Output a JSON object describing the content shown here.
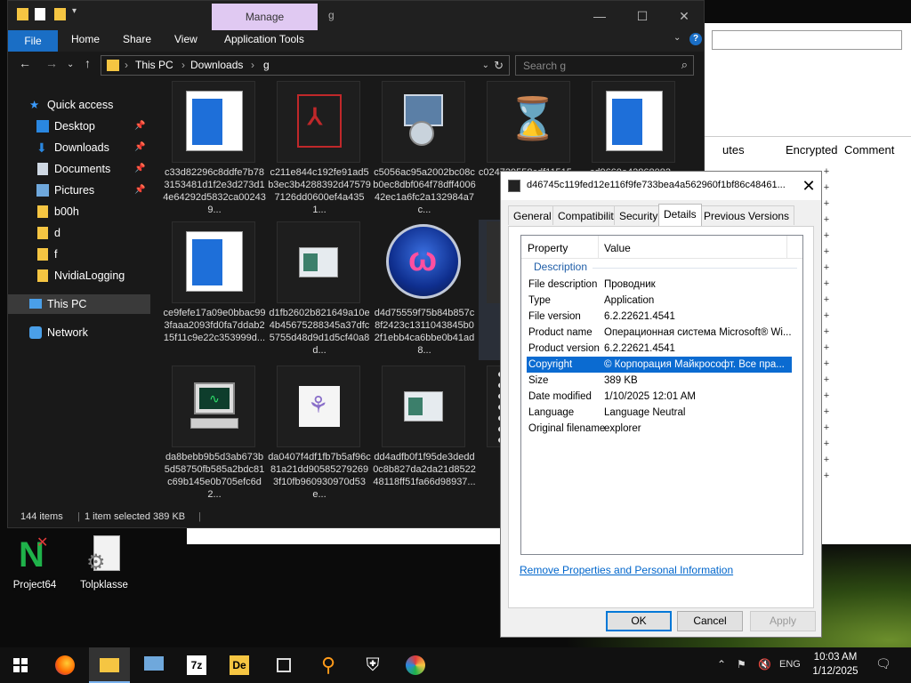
{
  "background_window": {
    "columns": [
      "utes",
      "Encrypted",
      "Comment"
    ],
    "plus_marks": [
      "+",
      "+",
      "+",
      "+",
      "+",
      "+",
      "+",
      "+",
      "+",
      "+",
      "+",
      "+",
      "+",
      "+",
      "+",
      "+",
      "+",
      "+",
      "+",
      "+"
    ]
  },
  "explorer": {
    "manage_tab": "Manage",
    "title": "g",
    "ribbon_tabs": [
      "File",
      "Home",
      "Share",
      "View",
      "Application Tools"
    ],
    "breadcrumb": [
      "This PC",
      "Downloads",
      "g"
    ],
    "search_placeholder": "Search g",
    "nav": {
      "quick_access": "Quick access",
      "desktop": "Desktop",
      "downloads": "Downloads",
      "documents": "Documents",
      "pictures": "Pictures",
      "b00h": "b00h",
      "d": "d",
      "f": "f",
      "nvidia": "NvidiaLogging",
      "this_pc": "This PC",
      "network": "Network"
    },
    "files": [
      {
        "name": "c33d82296c8ddfe7b783153481d1f2e3d273d14e64292d5832ca002439..."
      },
      {
        "name": "c211e844c192fe91ad5b3ec3b4288392d475797126dd0600ef4a4351..."
      },
      {
        "name": "c5056ac95a2002bc08cb0ec8dbf064f78dff400642ec1a6fc2a132984a7c..."
      },
      {
        "name": "c024729558cdf11515..."
      },
      {
        "name": "cd9660e42868082..."
      },
      {
        "name": "ce9fefe17a09e0bbac993faaa2093fd0fa7ddab215f11c9e22c353999d..."
      },
      {
        "name": "d1fb2602b821649a10e4b45675288345a37dfc5755d48d9d1d5cf40a8d..."
      },
      {
        "name": "d4d75559f75b84b857c8f2423c1311043845b02f1ebb4ca6bbe0b41ad8..."
      },
      {
        "name": "d46..."
      },
      {
        "name": "da8bebb9b5d3ab673b5d58750fb585a2bdc81c69b145e0b705efc6d2..."
      },
      {
        "name": "da0407f4df1fb7b5af96c81a21dd905852792693f10fb960930970d53e..."
      },
      {
        "name": "dd4adfb0f1f95de3dedd0c8b827da2da21d852248118ff51fa66d98937..."
      },
      {
        "name": "dd5..."
      }
    ],
    "status": {
      "items": "144 items",
      "selected": "1 item selected  389 KB"
    }
  },
  "dialog": {
    "title": "d46745c119fed12e116f9fe733bea4a562960f1bf86c48461...",
    "tabs": [
      "General",
      "Compatibility",
      "Security",
      "Details",
      "Previous Versions"
    ],
    "columns": {
      "property": "Property",
      "value": "Value"
    },
    "group": "Description",
    "rows": [
      {
        "k": "File description",
        "v": "Проводник"
      },
      {
        "k": "Type",
        "v": "Application"
      },
      {
        "k": "File version",
        "v": "6.2.22621.4541"
      },
      {
        "k": "Product name",
        "v": "Операционная система Microsoft® Wi..."
      },
      {
        "k": "Product version",
        "v": "6.2.22621.4541"
      },
      {
        "k": "Copyright",
        "v": "© Корпорация Майкрософт. Все пра..."
      },
      {
        "k": "Size",
        "v": "389 KB"
      },
      {
        "k": "Date modified",
        "v": "1/10/2025 12:01 AM"
      },
      {
        "k": "Language",
        "v": "Language Neutral"
      },
      {
        "k": "Original filename",
        "v": "explorer"
      }
    ],
    "remove_link": "Remove Properties and Personal Information",
    "ok": "OK",
    "cancel": "Cancel",
    "apply": "Apply"
  },
  "desktop_icons": {
    "project64": "Project64",
    "tolpklasse": "Tolpklasse"
  },
  "taskbar": {
    "lang": "ENG",
    "time": "10:03 AM",
    "date": "1/12/2025"
  },
  "colors": {
    "accent": "#1a6ec5",
    "manage_tab": "#e0c9f2",
    "selection": "#0b6bd1"
  }
}
